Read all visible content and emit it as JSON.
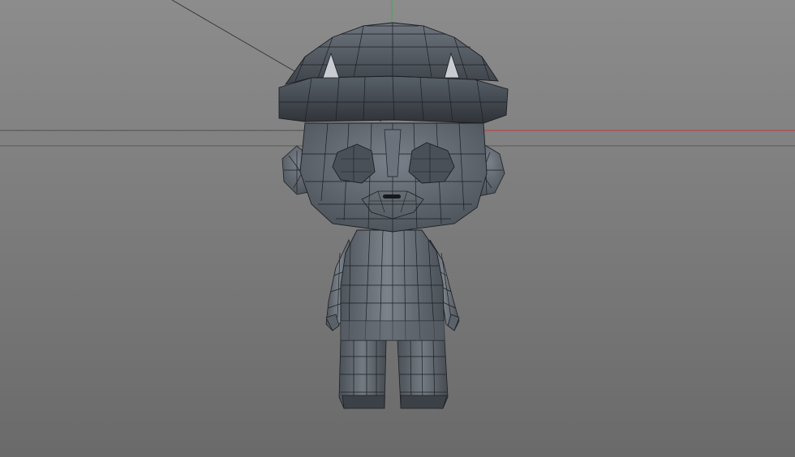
{
  "viewport": {
    "view": "perspective",
    "shading": "gouraud-shading-with-lines",
    "background_color": "#7f7f7f",
    "model": {
      "name": "",
      "kind": "low-poly chibi character (boy with helmet-cap)",
      "mesh_color": "#5f6670",
      "wire_color": "#1c1f24"
    },
    "axes": {
      "x_axis_color": "#c03a3a",
      "y_axis_color": "#3fae48",
      "grid_horizon_color": "#4d4d4d"
    }
  }
}
